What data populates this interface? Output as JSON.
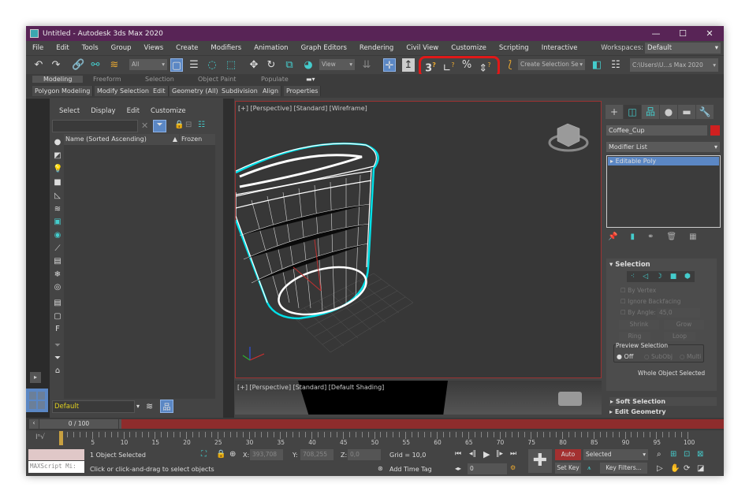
{
  "window": {
    "title": "Untitled - Autodesk 3ds Max 2020",
    "minimize": "—",
    "maximize": "☐",
    "close": "✕"
  },
  "menu": [
    "File",
    "Edit",
    "Tools",
    "Group",
    "Views",
    "Create",
    "Modifiers",
    "Animation",
    "Graph Editors",
    "Rendering",
    "Civil View",
    "Customize",
    "Scripting",
    "Interactive"
  ],
  "workspaces": {
    "label": "Workspaces:",
    "value": "Default"
  },
  "toolbar": {
    "filter": "All",
    "ref_coord": "View",
    "selection_set": "Create Selection Se",
    "project_path": "C:\\Users\\U...s Max 2020",
    "highlight_color": "#e01818"
  },
  "ribbon": {
    "tabs": [
      "Modeling",
      "Freeform",
      "Selection",
      "Object Paint",
      "Populate"
    ],
    "panels": [
      "Polygon Modeling",
      "Modify Selection",
      "Edit",
      "Geometry (All)",
      "Subdivision",
      "Align",
      "Properties"
    ]
  },
  "explorer": {
    "menu": [
      "Select",
      "Display",
      "Edit",
      "Customize"
    ],
    "search_placeholder": "",
    "columns": [
      "Name (Sorted Ascending)",
      "Frozen"
    ],
    "layer": "Default"
  },
  "viewports": {
    "main": "[+] [Perspective] [Standard] [Wireframe]",
    "bottom": "[+] [Perspective] [Standard] [Default Shading]"
  },
  "command_panel": {
    "object_name": "Coffee_Cup",
    "object_color": "#d02020",
    "modifier_list": "Modifier List",
    "stack": [
      "Editable Poly"
    ],
    "selection": {
      "title": "Selection",
      "by_vertex": "By Vertex",
      "ignore_backfacing": "Ignore Backfacing",
      "by_angle": "By Angle:",
      "angle_value": "45,0",
      "shrink": "Shrink",
      "grow": "Grow",
      "ring": "Ring",
      "loop": "Loop",
      "preview": "Preview Selection",
      "off": "Off",
      "subobj": "SubObj",
      "multi": "Multi",
      "status": "Whole Object Selected"
    },
    "soft_selection": "Soft Selection",
    "edit_geometry": "Edit Geometry"
  },
  "timeline": {
    "frame": "0 / 100",
    "ticks": [
      "0",
      "5",
      "10",
      "15",
      "20",
      "25",
      "30",
      "35",
      "40",
      "45",
      "50",
      "55",
      "60",
      "65",
      "70",
      "75",
      "80",
      "85",
      "90",
      "95",
      "100"
    ]
  },
  "status": {
    "maxscript": "MAXScript Mi:",
    "selected": "1 Object Selected",
    "prompt": "Click or click-and-drag to select objects",
    "x_label": "X:",
    "x": "393,708",
    "y_label": "Y:",
    "y": "708,255",
    "z_label": "Z:",
    "z": "0,0",
    "grid": "Grid = 10,0",
    "add_time_tag": "Add Time Tag",
    "auto_key": "Auto Key",
    "set_key": "Set Key",
    "key_mode": "Selected",
    "key_filters": "Key Filters...",
    "current_frame": "0"
  }
}
